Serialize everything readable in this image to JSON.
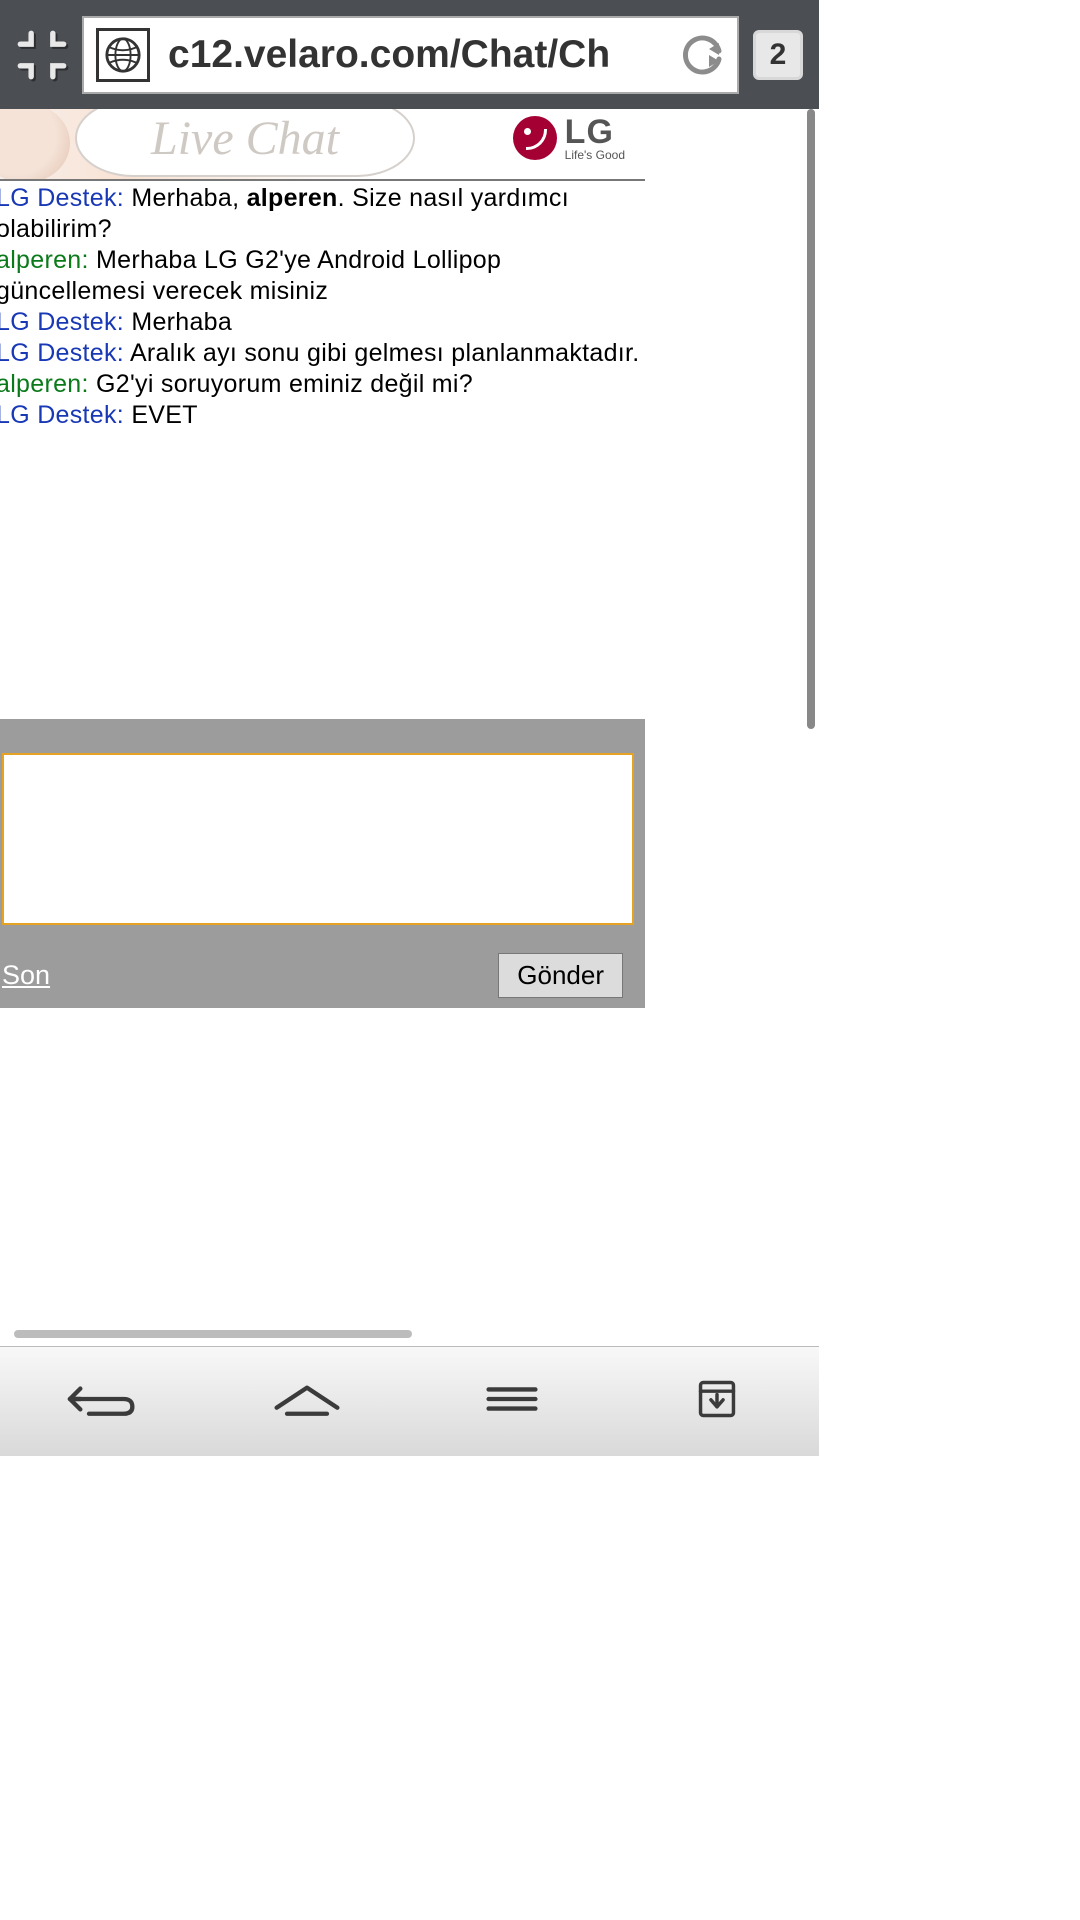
{
  "browser": {
    "url": "c12.velaro.com/Chat/Ch",
    "tab_count": "2"
  },
  "header": {
    "title": "Live Chat",
    "brand": "LG",
    "tagline": "Life's Good"
  },
  "chat": {
    "agent_name": "LG Destek",
    "user_name": "alperen",
    "messages": [
      {
        "who": "agent",
        "prefix": "LG Destek:",
        "before": "Merhaba, ",
        "bold": "alperen",
        "after": ". Size nasıl yardımcı olabilirim?"
      },
      {
        "who": "user",
        "prefix": "alperen:",
        "text": "Merhaba LG G2'ye Android Lollipop güncellemesi verecek misiniz"
      },
      {
        "who": "agent",
        "prefix": "LG Destek:",
        "text": "Merhaba"
      },
      {
        "who": "agent",
        "prefix": "LG Destek:",
        "text": "Aralık ayı sonu gibi gelmesı planlanmaktadır."
      },
      {
        "who": "user",
        "prefix": "alperen:",
        "text": "G2'yi soruyorum eminiz değil mi?"
      },
      {
        "who": "agent",
        "prefix": "LG Destek:",
        "text": "EVET"
      }
    ],
    "end_link": "Son",
    "send_button": "Gönder",
    "input_value": ""
  }
}
